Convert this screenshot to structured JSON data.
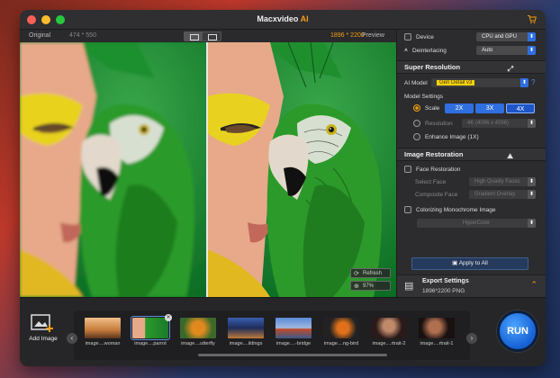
{
  "window": {
    "title": "Macxvideo",
    "title_suffix": "AI"
  },
  "viewbar": {
    "original_label": "Original",
    "original_res": "474 * 550",
    "output_res": "1896 * 2200",
    "preview_label": "Preview"
  },
  "preview_buttons": {
    "refresh": "Refresh",
    "zoom": "97%"
  },
  "panel": {
    "device_label": "Device",
    "device_value": "CPU and GPU",
    "deinterlacing_label": "Deinterlacing",
    "deinterlacing_value": "Auto",
    "super_resolution": {
      "title": "Super Resolution",
      "ai_model_label": "AI Model",
      "ai_model_value": "Gen Detail v3",
      "model_settings_label": "Model Settings",
      "scale_label": "Scale",
      "scale_options": [
        "2X",
        "3X",
        "4X"
      ],
      "scale_selected": "4X",
      "resolution_label": "Resolution",
      "resolution_value": "4K (4096 x 4096)",
      "enhance_label": "Enhance Image (1X)"
    },
    "image_restoration": {
      "title": "Image Restoration",
      "face_label": "Face Restoration",
      "select_face_label": "Select Face",
      "select_face_value": "High Quality Faces",
      "composite_face_label": "Composite Face",
      "composite_face_value": "Gradient Overlay",
      "colorizing_label": "Colorizing Monochrome Image",
      "colorizing_value": "HyperColor"
    },
    "apply_all": "Apply to All",
    "export": {
      "title": "Export Settings",
      "detail": "1896*2200 PNG"
    }
  },
  "bottom": {
    "add_image": "Add Image",
    "thumbnails": [
      {
        "caption": "image....woman"
      },
      {
        "caption": "image....parrot"
      },
      {
        "caption": "image....utterfly"
      },
      {
        "caption": "image....ildings"
      },
      {
        "caption": "image....-bridge"
      },
      {
        "caption": "image....ng-bird"
      },
      {
        "caption": "image....rtrait-2"
      },
      {
        "caption": "image....rtrait-1"
      }
    ],
    "selected_index": 1,
    "run_label": "RUN"
  },
  "colors": {
    "accent": "#f39c12",
    "blue": "#2f6fe0",
    "highlight": "#ffd400"
  }
}
